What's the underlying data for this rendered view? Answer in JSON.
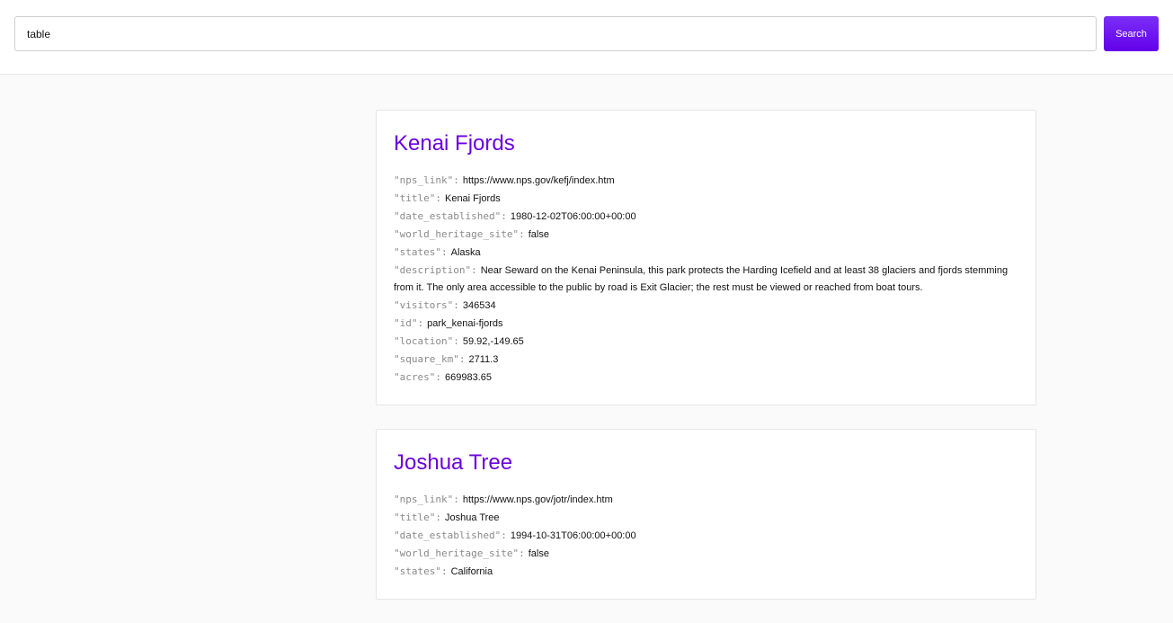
{
  "search": {
    "value": "table",
    "button_label": "Search"
  },
  "results": [
    {
      "heading": "Kenai Fjords",
      "fields": [
        {
          "key": "\"nps_link\":",
          "value": "https://www.nps.gov/kefj/index.htm"
        },
        {
          "key": "\"title\":",
          "value": "Kenai Fjords"
        },
        {
          "key": "\"date_established\":",
          "value": "1980-12-02T06:00:00+00:00"
        },
        {
          "key": "\"world_heritage_site\":",
          "value": "false"
        },
        {
          "key": "\"states\":",
          "value": "Alaska"
        },
        {
          "key": "\"description\":",
          "value": "Near Seward on the Kenai Peninsula, this park protects the Harding Icefield and at least 38 glaciers and fjords stemming from it. The only area accessible to the public by road is Exit Glacier; the rest must be viewed or reached from boat tours."
        },
        {
          "key": "\"visitors\":",
          "value": "346534"
        },
        {
          "key": "\"id\":",
          "value": "park_kenai-fjords"
        },
        {
          "key": "\"location\":",
          "value": "59.92,-149.65"
        },
        {
          "key": "\"square_km\":",
          "value": "2711.3"
        },
        {
          "key": "\"acres\":",
          "value": "669983.65"
        }
      ]
    },
    {
      "heading": "Joshua Tree",
      "fields": [
        {
          "key": "\"nps_link\":",
          "value": "https://www.nps.gov/jotr/index.htm"
        },
        {
          "key": "\"title\":",
          "value": "Joshua Tree"
        },
        {
          "key": "\"date_established\":",
          "value": "1994-10-31T06:00:00+00:00"
        },
        {
          "key": "\"world_heritage_site\":",
          "value": "false"
        },
        {
          "key": "\"states\":",
          "value": "California"
        }
      ]
    }
  ]
}
